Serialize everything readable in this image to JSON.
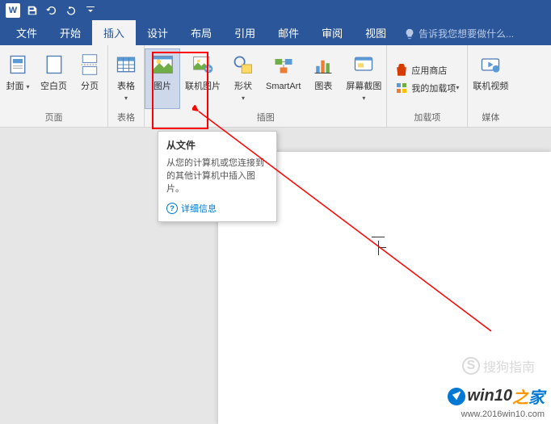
{
  "titlebar": {
    "save_icon": "save",
    "undo_icon": "undo",
    "redo_icon": "redo"
  },
  "tabs": {
    "file": "文件",
    "home": "开始",
    "insert": "插入",
    "design": "设计",
    "layout": "布局",
    "references": "引用",
    "mailings": "邮件",
    "review": "审阅",
    "view": "视图",
    "tell_me": "告诉我您想要做什么..."
  },
  "groups": {
    "pages": "页面",
    "tables": "表格",
    "illustrations": "插图",
    "addins": "加载项",
    "media": "媒体"
  },
  "buttons": {
    "cover_page": "封面",
    "blank_page": "空白页",
    "page_break": "分页",
    "table": "表格",
    "pictures": "图片",
    "online_pictures": "联机图片",
    "shapes": "形状",
    "smartart": "SmartArt",
    "chart": "图表",
    "screenshot": "屏幕截图",
    "app_store": "应用商店",
    "my_addins": "我的加载项",
    "online_video": "联机视频"
  },
  "tooltip": {
    "title": "从文件",
    "desc": "从您的计算机或您连接到的其他计算机中插入图片。",
    "more": "详细信息"
  },
  "watermark": "搜狗指南",
  "branding": {
    "logo_text_prefix": "win10",
    "logo_zhi": "之",
    "logo_jia": "家",
    "url": "www.2016win10.com"
  }
}
